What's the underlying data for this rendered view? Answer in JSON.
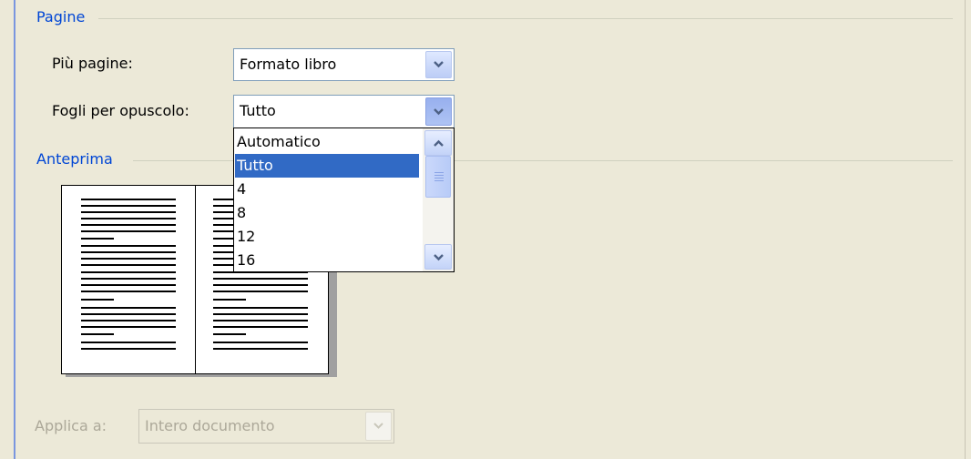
{
  "pages_group": {
    "title": "Pagine",
    "multiple_pages": {
      "label": "Più pagine:",
      "value": "Formato libro"
    },
    "sheets_per_booklet": {
      "label": "Fogli per opuscolo:",
      "value": "Tutto",
      "options": [
        "Automatico",
        "Tutto",
        "4",
        "8",
        "12",
        "16"
      ],
      "selected_index": 1
    }
  },
  "preview_group": {
    "title": "Anteprima"
  },
  "apply_to": {
    "label": "Applica a:",
    "value": "Intero documento",
    "enabled": false
  },
  "colors": {
    "group_title": "#0046d5",
    "selection": "#316ac5",
    "dialog_bg": "#ece9d8"
  }
}
